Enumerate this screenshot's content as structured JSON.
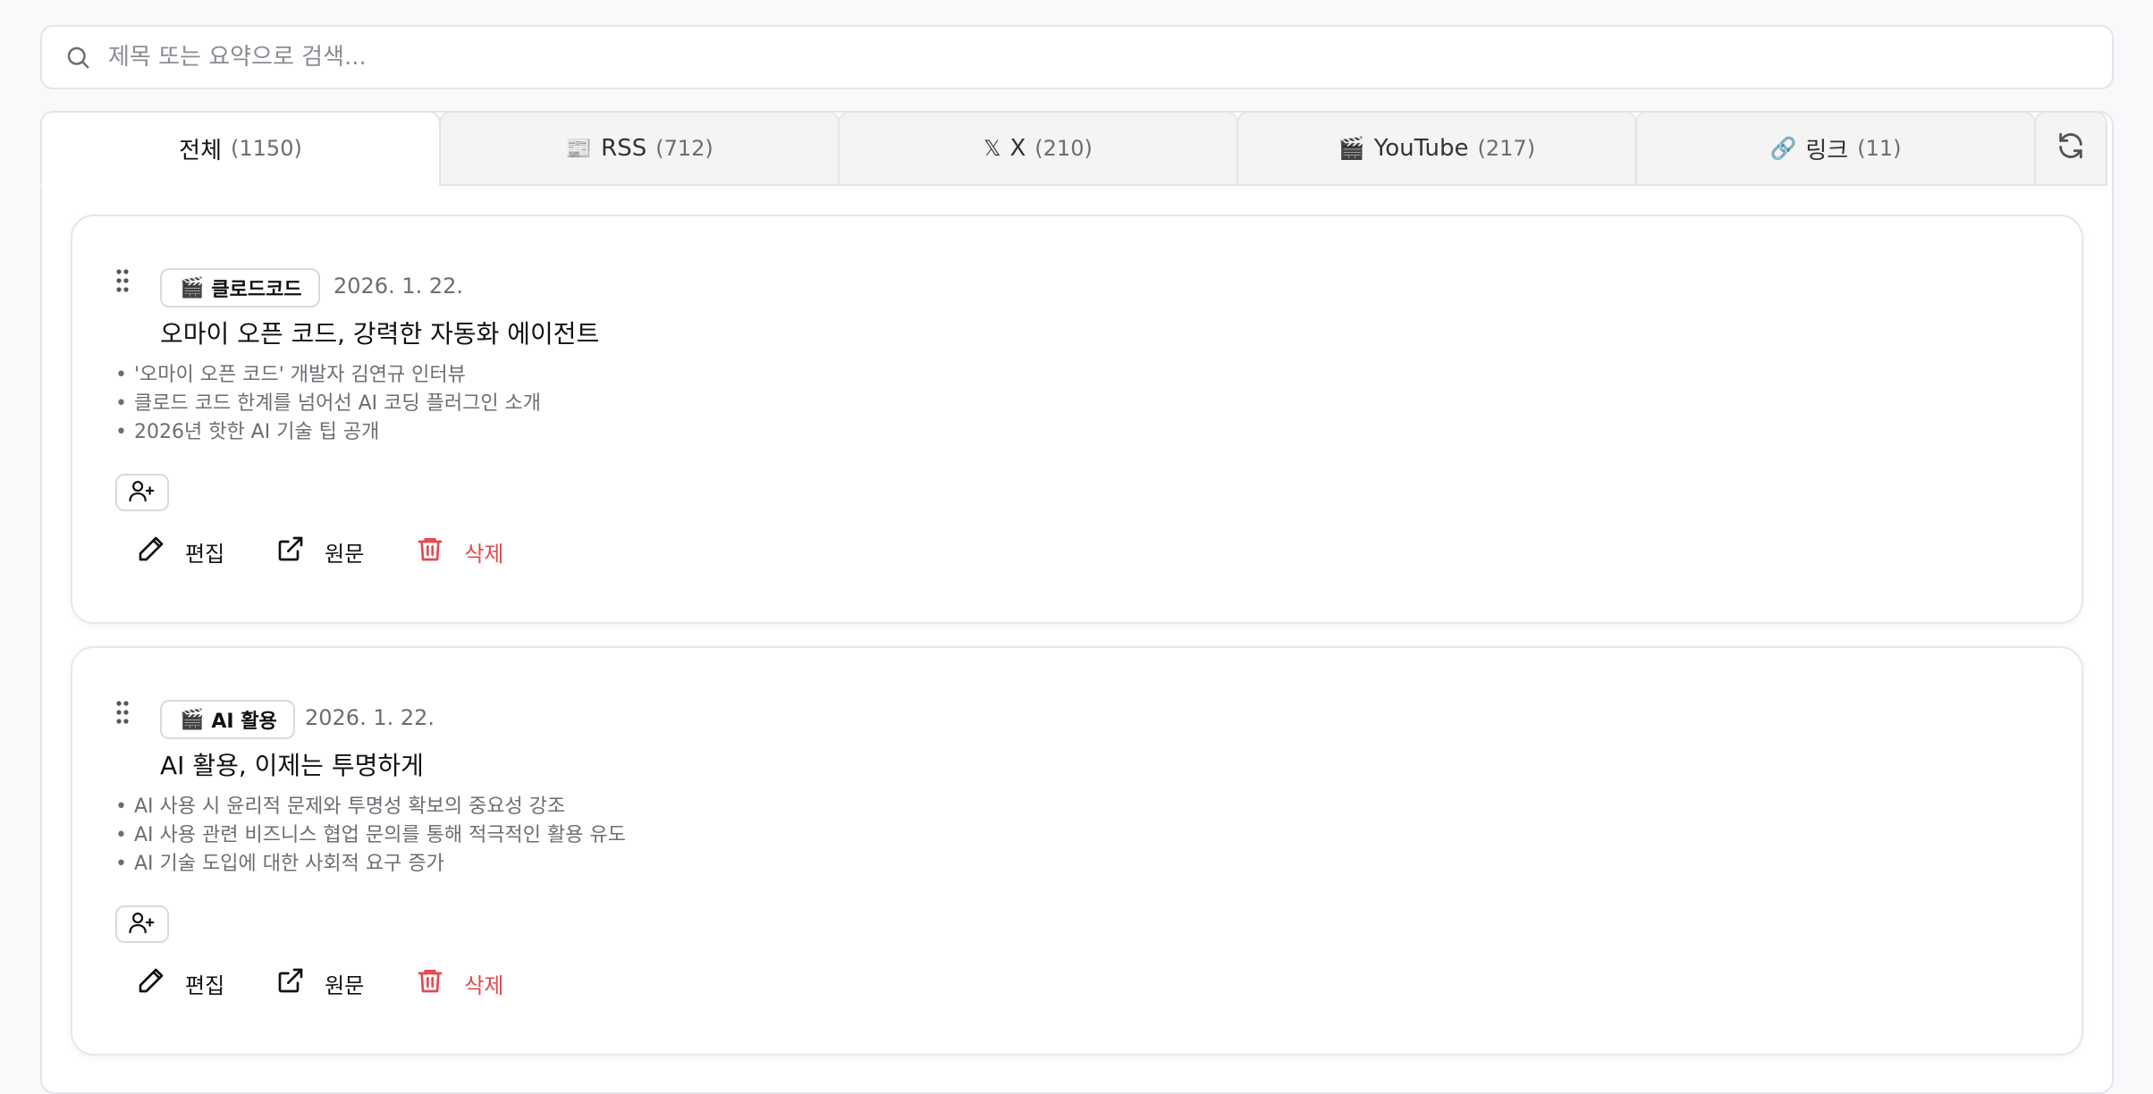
{
  "search": {
    "placeholder": "제목 또는 요약으로 검색..."
  },
  "tabs": [
    {
      "icon": "",
      "label": "전체",
      "count": "(1150)",
      "active": true
    },
    {
      "icon": "newspaper-icon",
      "glyph": "📰",
      "label": "RSS",
      "count": "(712)"
    },
    {
      "icon": "x-logo-icon",
      "glyph": "𝕏",
      "label": "X",
      "count": "(210)"
    },
    {
      "icon": "clapper-icon",
      "glyph": "🎬",
      "label": "YouTube",
      "count": "(217)"
    },
    {
      "icon": "link-icon",
      "glyph": "🔗",
      "label": "링크",
      "count": "(11)"
    }
  ],
  "refresh_icon": "refresh-icon",
  "cards": [
    {
      "tag_glyph": "🎬",
      "tag_label": "클로드코드",
      "date": "2026. 1. 22.",
      "title": "오마이 오픈 코드, 강력한 자동화 에이전트",
      "bullets": [
        "'오마이 오픈 코드' 개발자 김연규 인터뷰",
        "클로드 코드 한계를 넘어선 AI 코딩 플러그인 소개",
        "2026년 핫한 AI 기술 팁 공개"
      ],
      "actions": {
        "edit": "편집",
        "original": "원문",
        "delete": "삭제"
      }
    },
    {
      "tag_glyph": "🎬",
      "tag_label": "AI 활용",
      "date": "2026. 1. 22.",
      "title": "AI 활용, 이제는 투명하게",
      "bullets": [
        "AI 사용 시 윤리적 문제와 투명성 확보의 중요성 강조",
        "AI 사용 관련 비즈니스 협업 문의를 통해 적극적인 활용 유도",
        "AI 기술 도입에 대한 사회적 요구 증가"
      ],
      "actions": {
        "edit": "편집",
        "original": "원문",
        "delete": "삭제"
      }
    }
  ],
  "colors": {
    "delete": "#e5484d",
    "muted_text": "#6b6e73",
    "border": "#e3e5e8"
  }
}
